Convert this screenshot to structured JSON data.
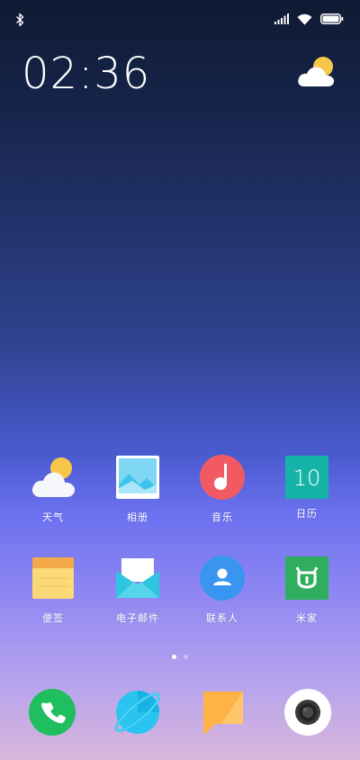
{
  "status_bar": {
    "left_icon": "bluetooth-icon",
    "right_icons": [
      "signal-icon",
      "wifi-icon",
      "battery-icon"
    ]
  },
  "clock": {
    "time": "02:36"
  },
  "weather_widget": {
    "icon": "partly-cloudy-icon"
  },
  "apps": [
    {
      "label": "天气",
      "icon": "weather-icon"
    },
    {
      "label": "相册",
      "icon": "gallery-icon"
    },
    {
      "label": "音乐",
      "icon": "music-icon"
    },
    {
      "label": "日历",
      "icon": "calendar-icon",
      "day": "10"
    },
    {
      "label": "便签",
      "icon": "notes-icon"
    },
    {
      "label": "电子邮件",
      "icon": "email-icon"
    },
    {
      "label": "联系人",
      "icon": "contacts-icon"
    },
    {
      "label": "米家",
      "icon": "mi-home-icon"
    }
  ],
  "page_indicator": {
    "pages": 2,
    "current": 1
  },
  "dock": [
    {
      "icon": "phone-icon"
    },
    {
      "icon": "browser-icon"
    },
    {
      "icon": "messages-icon"
    },
    {
      "icon": "camera-icon"
    }
  ],
  "colors": {
    "phone_green": "#1fbf5f",
    "browser_cyan": "#2ac4f0",
    "messages_orange": "#ffb347",
    "music_red": "#f25a63",
    "calendar_teal": "#16b3a8",
    "contacts_blue": "#3a95f0",
    "mihome_green": "#2fae5e"
  }
}
